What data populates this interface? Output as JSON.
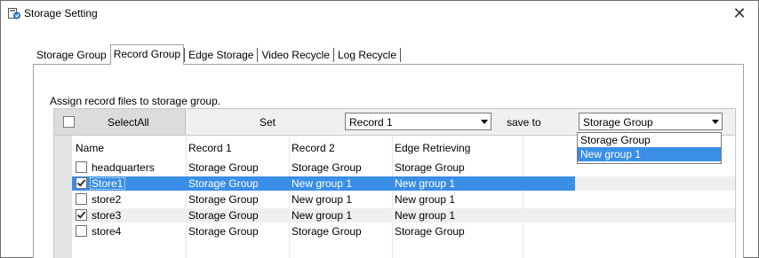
{
  "window": {
    "title": "Storage Setting",
    "close_glyph": "✕",
    "icon": "storage-app-icon"
  },
  "tabs": [
    {
      "label": "Storage Group",
      "active": false
    },
    {
      "label": "Record Group",
      "active": true
    },
    {
      "label": "Edge Storage",
      "active": false
    },
    {
      "label": "Video Recycle",
      "active": false
    },
    {
      "label": "Log Recycle",
      "active": false
    }
  ],
  "panel": {
    "instruction": "Assign record files to storage group."
  },
  "toolbar": {
    "select_all_label": "SelectAll",
    "set_label": "Set",
    "record_combo_value": "Record 1",
    "save_to_label": "save to",
    "group_combo_value": "Storage Group"
  },
  "dropdown": {
    "options": [
      "Storage Group",
      "New group 1"
    ],
    "highlighted": "New group 1"
  },
  "grid": {
    "columns": [
      "Name",
      "Record 1",
      "Record 2",
      "Edge Retrieving"
    ],
    "rows": [
      {
        "checked": false,
        "name": "headquarters",
        "record1": "Storage Group",
        "record2": "Storage Group",
        "edge": "Storage Group"
      },
      {
        "checked": true,
        "name": "Store1",
        "record1": "Storage Group",
        "record2": "New group 1",
        "edge": "New group 1"
      },
      {
        "checked": false,
        "name": "store2",
        "record1": "Storage Group",
        "record2": "New group 1",
        "edge": "New group 1"
      },
      {
        "checked": true,
        "name": "store3",
        "record1": "Storage Group",
        "record2": "New group 1",
        "edge": "New group 1"
      },
      {
        "checked": false,
        "name": "store4",
        "record1": "Storage Group",
        "record2": "Storage Group",
        "edge": "Storage Group"
      }
    ]
  },
  "colors": {
    "selection": "#3a8ee6",
    "gutter": "#e3e3e3",
    "alt_row": "#efefef"
  }
}
